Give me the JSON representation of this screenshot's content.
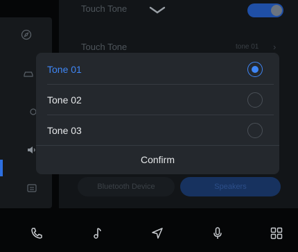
{
  "background": {
    "header_title": "Touch Tone",
    "row_label": "Touch Tone",
    "row_value": "tone 01",
    "segments": [
      "Bluetooth Device",
      "Speakers"
    ]
  },
  "dialog": {
    "options": [
      {
        "label": "Tone 01",
        "selected": true
      },
      {
        "label": "Tone 02",
        "selected": false
      },
      {
        "label": "Tone 03",
        "selected": false
      }
    ],
    "confirm_label": "Confirm"
  },
  "bottom_nav": {
    "items": [
      "phone-icon",
      "music-icon",
      "navigation-icon",
      "microphone-icon",
      "apps-grid-icon"
    ]
  },
  "colors": {
    "accent": "#3f86f5",
    "dialog_bg": "#24282d",
    "page_bg": "#050607"
  }
}
